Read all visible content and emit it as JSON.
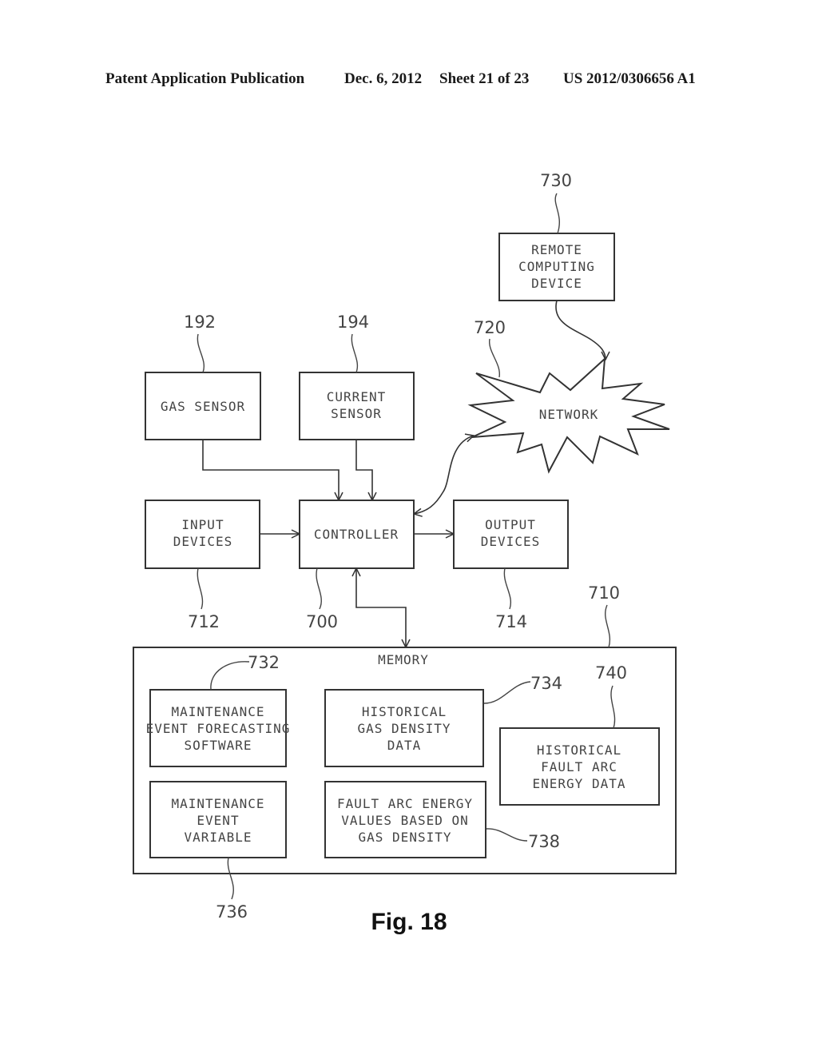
{
  "header": {
    "publication": "Patent Application Publication",
    "date": "Dec. 6, 2012",
    "sheet": "Sheet 21 of 23",
    "number": "US 2012/0306656 A1"
  },
  "figure_label": "Fig. 18",
  "nodes": {
    "remote": {
      "lines": [
        "REMOTE",
        "COMPUTING",
        "DEVICE"
      ],
      "ref": "730"
    },
    "network": {
      "lines": [
        "NETWORK"
      ],
      "ref": "720"
    },
    "gas_sensor": {
      "lines": [
        "GAS SENSOR"
      ],
      "ref": "192"
    },
    "current_sensor": {
      "lines": [
        "CURRENT",
        "SENSOR"
      ],
      "ref": "194"
    },
    "input_devices": {
      "lines": [
        "INPUT",
        "DEVICES"
      ],
      "ref": "712"
    },
    "controller": {
      "lines": [
        "CONTROLLER"
      ],
      "ref": "700"
    },
    "output_devices": {
      "lines": [
        "OUTPUT",
        "DEVICES"
      ],
      "ref": "714"
    },
    "memory": {
      "lines": [
        "MEMORY"
      ],
      "ref": "710"
    },
    "forecasting_software": {
      "lines": [
        "MAINTENANCE",
        "EVENT FORECASTING",
        "SOFTWARE"
      ],
      "ref": "732"
    },
    "historical_gas": {
      "lines": [
        "HISTORICAL",
        "GAS DENSITY",
        "DATA"
      ],
      "ref": "734"
    },
    "historical_fault": {
      "lines": [
        "HISTORICAL",
        "FAULT ARC",
        "ENERGY DATA"
      ],
      "ref": "740"
    },
    "event_variable": {
      "lines": [
        "MAINTENANCE",
        "EVENT",
        "VARIABLE"
      ],
      "ref": "736"
    },
    "fault_values": {
      "lines": [
        "FAULT ARC ENERGY",
        "VALUES BASED ON",
        "GAS DENSITY"
      ],
      "ref": "738"
    }
  },
  "edges": [
    {
      "from": "gas_sensor",
      "to": "controller",
      "direction": "forward"
    },
    {
      "from": "current_sensor",
      "to": "controller",
      "direction": "forward"
    },
    {
      "from": "input_devices",
      "to": "controller",
      "direction": "forward"
    },
    {
      "from": "controller",
      "to": "output_devices",
      "direction": "forward"
    },
    {
      "from": "network",
      "to": "controller",
      "direction": "bidirectional"
    },
    {
      "from": "remote",
      "to": "network",
      "direction": "forward"
    },
    {
      "from": "controller",
      "to": "memory",
      "direction": "bidirectional"
    }
  ]
}
